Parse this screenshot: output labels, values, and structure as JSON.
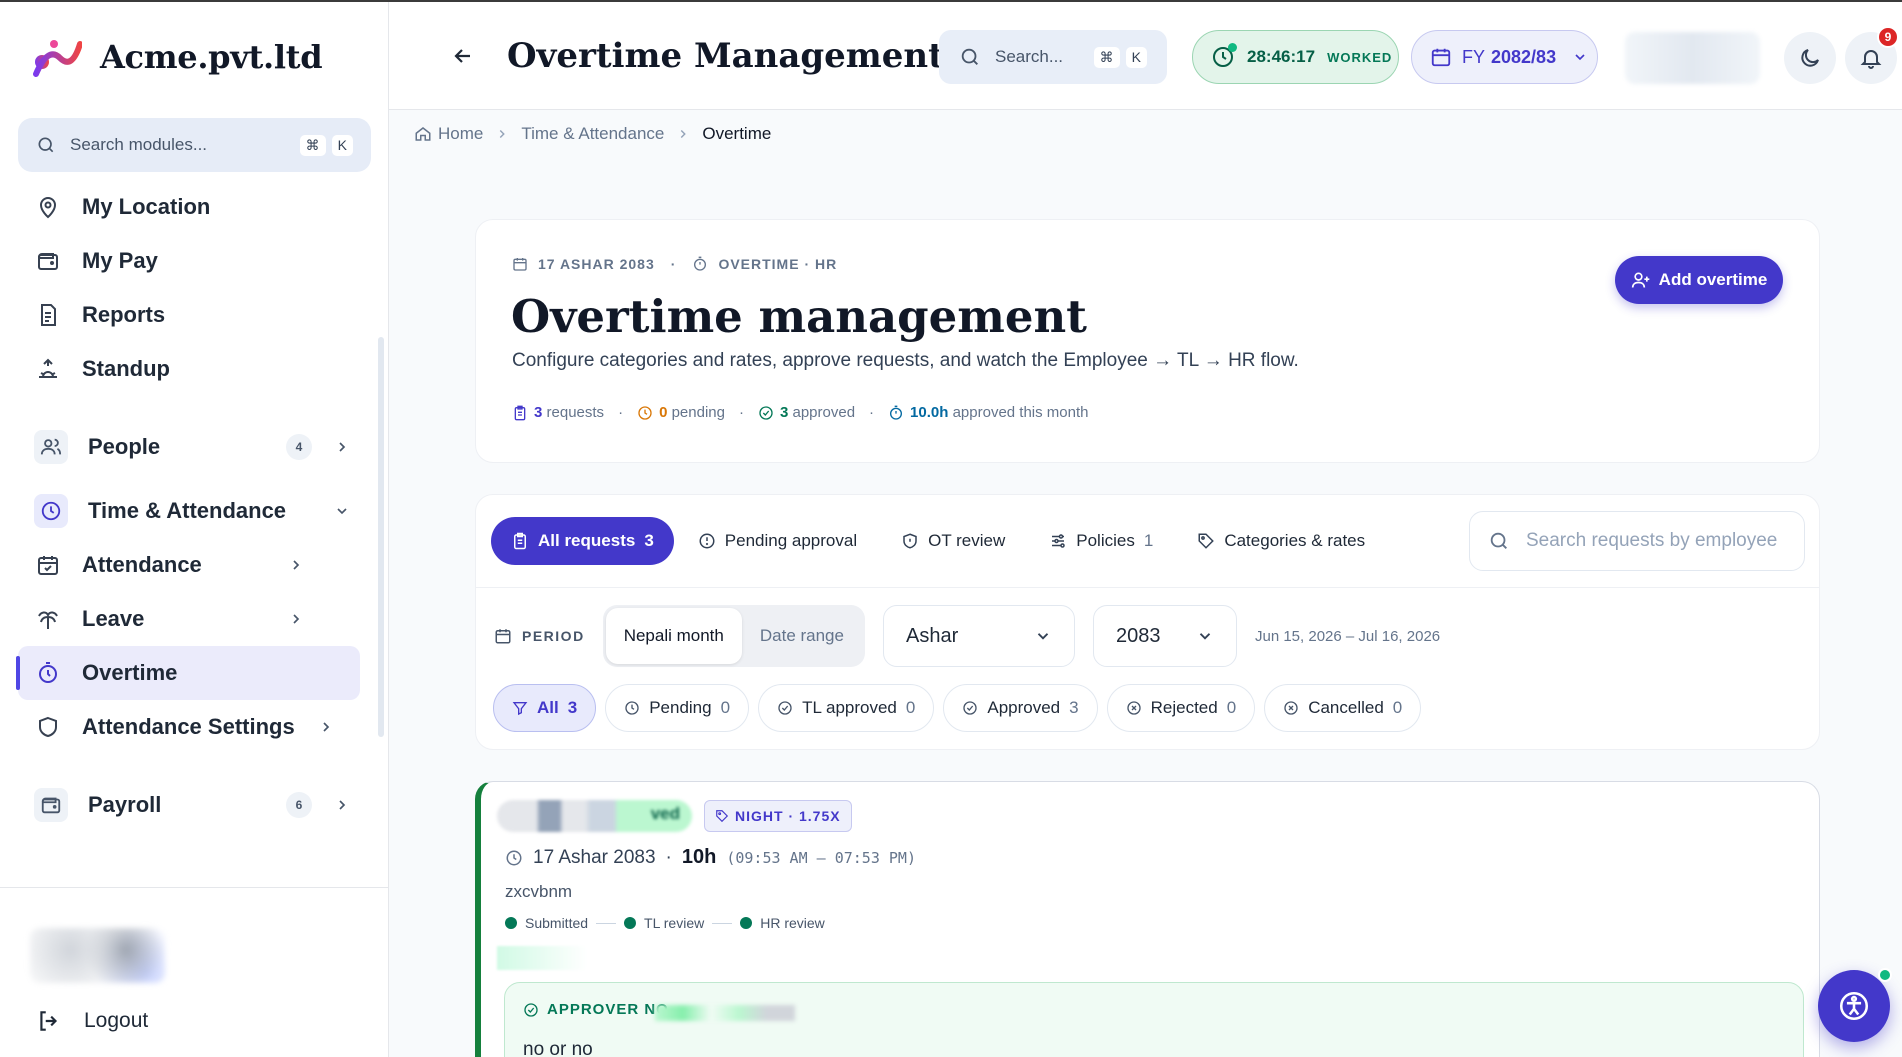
{
  "brand": {
    "name": "Acme.pvt.ltd"
  },
  "sidebar": {
    "search_placeholder": "Search modules...",
    "shortcut": [
      "⌘",
      "K"
    ],
    "items": [
      {
        "label": "My Location",
        "icon": "map-pin-icon"
      },
      {
        "label": "My Pay",
        "icon": "wallet-icon"
      },
      {
        "label": "Reports",
        "icon": "document-icon"
      },
      {
        "label": "Standup",
        "icon": "sunrise-icon"
      },
      {
        "label": "People",
        "icon": "users-icon",
        "count": "4"
      },
      {
        "label": "Time & Attendance",
        "icon": "clock-icon"
      },
      {
        "label": "Attendance",
        "icon": "calendar-check-icon"
      },
      {
        "label": "Leave",
        "icon": "palm-tree-icon"
      },
      {
        "label": "Overtime",
        "icon": "timer-icon",
        "active": true
      },
      {
        "label": "Attendance Settings",
        "icon": "shield-icon"
      },
      {
        "label": "Payroll",
        "icon": "wallet-icon",
        "count": "6"
      }
    ],
    "logout": "Logout"
  },
  "header": {
    "title": "Overtime Management",
    "search_placeholder": "Search...",
    "shortcut": [
      "⌘",
      "K"
    ],
    "worked_time": "28:46:17",
    "worked_label": "WORKED",
    "fiscal_year_prefix": "FY",
    "fiscal_year": "2082/83",
    "notification_count": "9"
  },
  "breadcrumb": {
    "home": "Home",
    "section": "Time & Attendance",
    "current": "Overtime"
  },
  "hero": {
    "date": "17 ASHAR 2083",
    "context": "OVERTIME · HR",
    "title": "Overtime management",
    "description": "Configure categories and rates, approve requests, and watch the Employee → TL → HR flow.",
    "stats": {
      "requests_count": "3",
      "requests_label": "requests",
      "pending_count": "0",
      "pending_label": "pending",
      "approved_count": "3",
      "approved_label": "approved",
      "hours_value": "10.0h",
      "hours_label": "approved this month"
    },
    "add_button": "Add overtime"
  },
  "tabs": [
    {
      "label": "All requests",
      "count": "3",
      "active": true
    },
    {
      "label": "Pending approval",
      "count": ""
    },
    {
      "label": "OT review",
      "count": ""
    },
    {
      "label": "Policies",
      "count": "1"
    },
    {
      "label": "Categories & rates",
      "count": ""
    }
  ],
  "request_search_placeholder": "Search requests by employee",
  "period": {
    "label": "PERIOD",
    "modes": [
      "Nepali month",
      "Date range"
    ],
    "month": "Ashar",
    "year": "2083",
    "range": "Jun 15, 2026 – Jul 16, 2026"
  },
  "status_filters": [
    {
      "label": "All",
      "count": "3"
    },
    {
      "label": "Pending",
      "count": "0"
    },
    {
      "label": "TL approved",
      "count": "0"
    },
    {
      "label": "Approved",
      "count": "3"
    },
    {
      "label": "Rejected",
      "count": "0"
    },
    {
      "label": "Cancelled",
      "count": "0"
    }
  ],
  "request": {
    "status_suffix": "ved",
    "category_tag": "NIGHT · 1.75X",
    "date": "17 Ashar 2083",
    "hours": "10h",
    "time_range": "(09:53 AM – 07:53 PM)",
    "note": "zxcvbnm",
    "flow": [
      "Submitted",
      "TL review",
      "HR review"
    ],
    "approver_label": "APPROVER NO",
    "approver_text": "no or no"
  },
  "colors": {
    "accent": "#4338ca",
    "success": "#047857",
    "danger": "#dc2626"
  }
}
